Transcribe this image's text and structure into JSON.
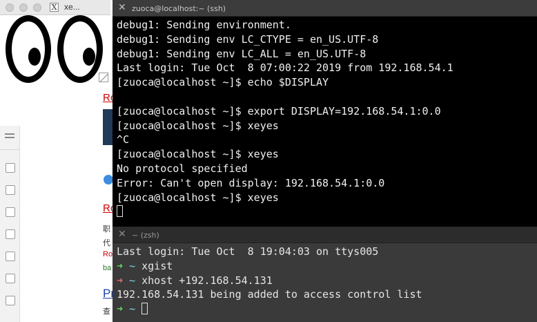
{
  "xeyes_window": {
    "title": "xe...",
    "x_glyph": "X"
  },
  "background_page": {
    "fragments": [
      "Ro",
      "Ro",
      "职",
      "代",
      "Ro",
      "ba",
      "Pr",
      "查"
    ]
  },
  "ssh_terminal": {
    "tab_title": "zuoca@localhost:~ (ssh)",
    "close_glyph": "✕",
    "lines": [
      "debug1: Sending environment.",
      "debug1: Sending env LC_CTYPE = en_US.UTF-8",
      "debug1: Sending env LC_ALL = en_US.UTF-8",
      "Last login: Tue Oct  8 07:00:22 2019 from 192.168.54.1",
      "[zuoca@localhost ~]$ echo $DISPLAY",
      "",
      "[zuoca@localhost ~]$ export DISPLAY=192.168.54.1:0.0",
      "[zuoca@localhost ~]$ xeyes",
      "^C",
      "[zuoca@localhost ~]$ xeyes",
      "No protocol specified",
      "Error: Can't open display: 192.168.54.1:0.0",
      "[zuoca@localhost ~]$ xeyes"
    ]
  },
  "zsh_terminal": {
    "tab_title": "~ (zsh)",
    "close_glyph": "✕",
    "last_login": "Last login: Tue Oct  8 19:04:03 on ttys005",
    "arrow": "➜",
    "tilde": "~",
    "cmd1": "xgist",
    "cmd2": "xhost +192.168.54.131",
    "output": "192.168.54.131 being added to access control list"
  },
  "colors": {
    "prompt_ok": "#5fd35f",
    "prompt_err": "#e06c6c",
    "tilde": "#7fd6e6"
  }
}
